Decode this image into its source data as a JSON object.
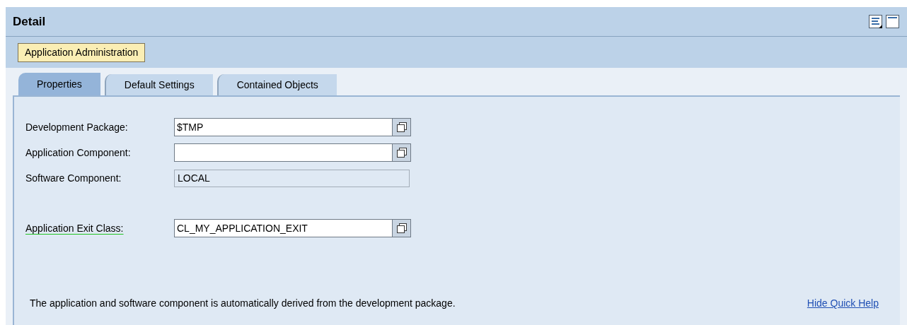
{
  "panel": {
    "title": "Detail"
  },
  "badge": "Application Administration",
  "tabs": [
    {
      "label": "Properties",
      "selected": true
    },
    {
      "label": "Default Settings",
      "selected": false
    },
    {
      "label": "Contained Objects",
      "selected": false
    }
  ],
  "fields": [
    {
      "label": "Development Package:",
      "value": "$TMP",
      "kind": "valuehelp",
      "label_underlined": false
    },
    {
      "label": "Application Component:",
      "kind": "valuehelp",
      "label_underlined": false
    },
    {
      "label": "Software Component:",
      "value": "LOCAL",
      "kind": "readonly",
      "label_underlined": false
    },
    {
      "label": "Application Exit Class:",
      "value": "CL_MY_APPLICATION_EXIT",
      "kind": "valuehelp",
      "label_underlined": true
    }
  ],
  "quick_help": {
    "text": "The application and software component is automatically derived from the development package.",
    "link": "Hide Quick Help"
  }
}
